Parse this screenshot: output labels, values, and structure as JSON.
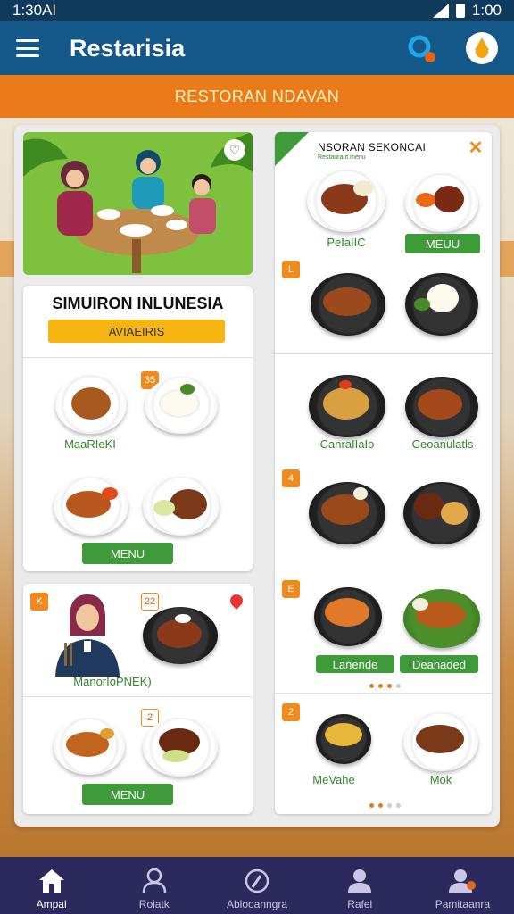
{
  "status_bar": {
    "time_left": "1:30AI",
    "time_right": "1:00"
  },
  "app_bar": {
    "title": "Restarisia"
  },
  "banner": {
    "text": "RESTORAN NDAVAN"
  },
  "left_column": {
    "intro_card": {
      "title": "SIMUIRON INLUNESIA",
      "pill": "AVIAEIRIS"
    },
    "dish_card_1": {
      "badge": "35",
      "label": "MaaRIeKI",
      "button": "MENU"
    },
    "dish_card_2": {
      "badge_a": "K",
      "badge_b": "22",
      "label": "ManorIoPNEK)"
    },
    "dish_card_3": {
      "badge": "2",
      "button": "MENU"
    }
  },
  "right_column": {
    "header_card": {
      "title": "NSORAN SEKONCAI",
      "subtitle": "Restaurant menu",
      "label_left": "PeIaIIC",
      "button_right": "MEUU"
    },
    "section_1": {
      "badge": "L"
    },
    "section_2": {
      "label_left": "CanraIIaIo",
      "label_right": "Ceoanulatls"
    },
    "section_3": {
      "badge": "4"
    },
    "section_4": {
      "badge": "E",
      "button_left": "Lanende",
      "button_right": "Deanaded"
    },
    "section_5": {
      "badge": "2",
      "label_left": "MeVahe",
      "label_right": "Mok"
    }
  },
  "bottom_nav": {
    "items": [
      {
        "label": "Ampal",
        "icon": "home-icon"
      },
      {
        "label": "Roiatk",
        "icon": "person-outline-icon"
      },
      {
        "label": "Ablooanngra",
        "icon": "compass-icon"
      },
      {
        "label": "Rafel",
        "icon": "profile-icon"
      },
      {
        "label": "Pamitaanra",
        "icon": "account-icon"
      }
    ]
  },
  "colors": {
    "app_bar": "#14588a",
    "banner": "#ea7a1a",
    "accent_green": "#3f9a3a",
    "nav": "#2c2a5c"
  }
}
